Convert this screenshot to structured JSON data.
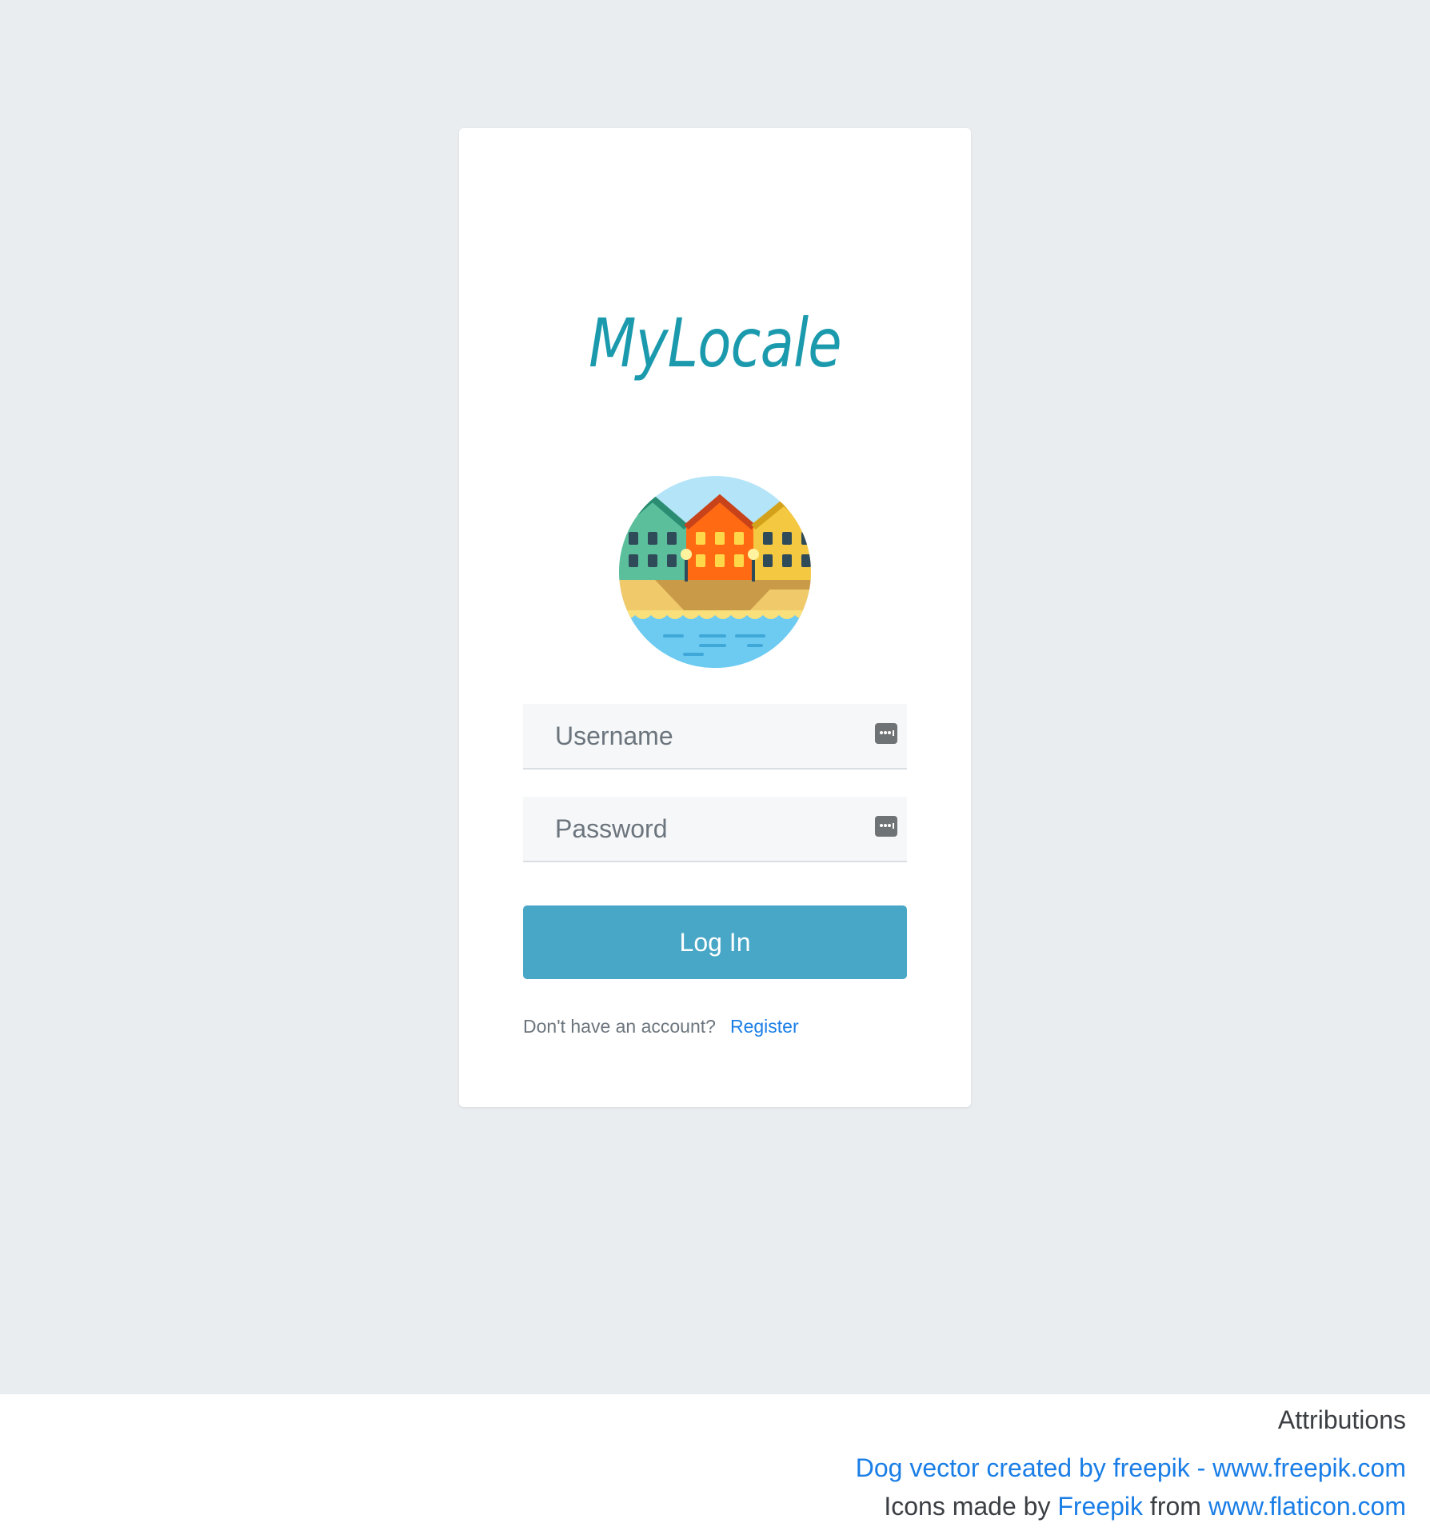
{
  "brand": {
    "title": "MyLocale",
    "color": "#1b9aad"
  },
  "logo": {
    "icon": "harbor-houses-icon"
  },
  "form": {
    "username": {
      "placeholder": "Username",
      "value": "",
      "icon": "keyboard-icon"
    },
    "password": {
      "placeholder": "Password",
      "value": "",
      "icon": "keyboard-icon"
    },
    "login_label": "Log In",
    "login_color": "#48a6c6",
    "register_prompt": "Don't have an account?",
    "register_label": "Register"
  },
  "footer": {
    "title": "Attributions",
    "dog_vector_link": "Dog vector created by freepik - www.freepik.com",
    "icons_prefix": "Icons made by",
    "freepik_link": "Freepik",
    "icons_middle": "from",
    "flaticon_link": "www.flaticon.com",
    "link_color": "#1a7ee6"
  },
  "colors": {
    "background": "#e9edf0",
    "card": "#ffffff",
    "field": "#f5f7f9"
  }
}
